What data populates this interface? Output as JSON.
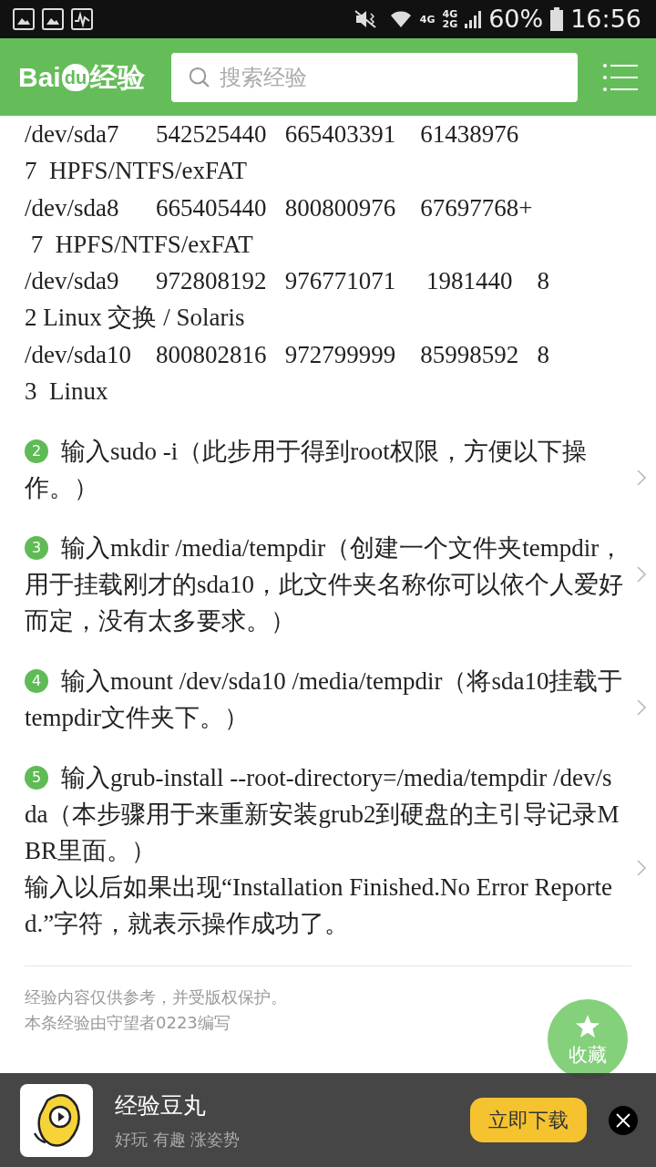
{
  "status_bar": {
    "battery": "60%",
    "time": "16:56",
    "network": [
      "4G",
      "4G",
      "2G"
    ]
  },
  "header": {
    "logo_left": "Bai",
    "logo_mid": "du",
    "logo_right": "经验",
    "search": {
      "placeholder": "搜索经验"
    }
  },
  "listing": [
    "/dev/sda7      542525440   665403391    61438976",
    "7  HPFS/NTFS/exFAT",
    "/dev/sda8      665405440   800800976    67697768+",
    " 7  HPFS/NTFS/exFAT",
    "/dev/sda9      972808192   976771071     1981440    8",
    "2 Linux 交换 / Solaris",
    "/dev/sda10    800802816   972799999    85998592   8",
    "3  Linux"
  ],
  "steps": [
    {
      "number": "2",
      "text": "输入sudo -i（此步用于得到root权限，方便以下操作。）"
    },
    {
      "number": "3",
      "text": "输入mkdir /media/tempdir（创建一个文件夹tempdir，用于挂载刚才的sda10，此文件夹名称你可以依个人爱好而定，没有太多要求。）"
    },
    {
      "number": "4",
      "text": "输入mount /dev/sda10 /media/tempdir（将sda10挂载于tempdir文件夹下。）"
    },
    {
      "number": "5",
      "text": "输入grub-install --root-directory=/media/tempdir /dev/sda（本步骤用于来重新安装grub2到硬盘的主引导记录MBR里面。）",
      "note": "输入以后如果出现“Installation Finished.No Error Reported.”字符，就表示操作成功了。"
    }
  ],
  "footer": [
    "经验内容仅供参考，并受版权保护。",
    "本条经验由守望者0223编写"
  ],
  "favorite": {
    "label": "收藏"
  },
  "banner": {
    "title": "经验豆丸",
    "subtitle": "好玩 有趣 涨姿势",
    "button": "立即下载"
  }
}
